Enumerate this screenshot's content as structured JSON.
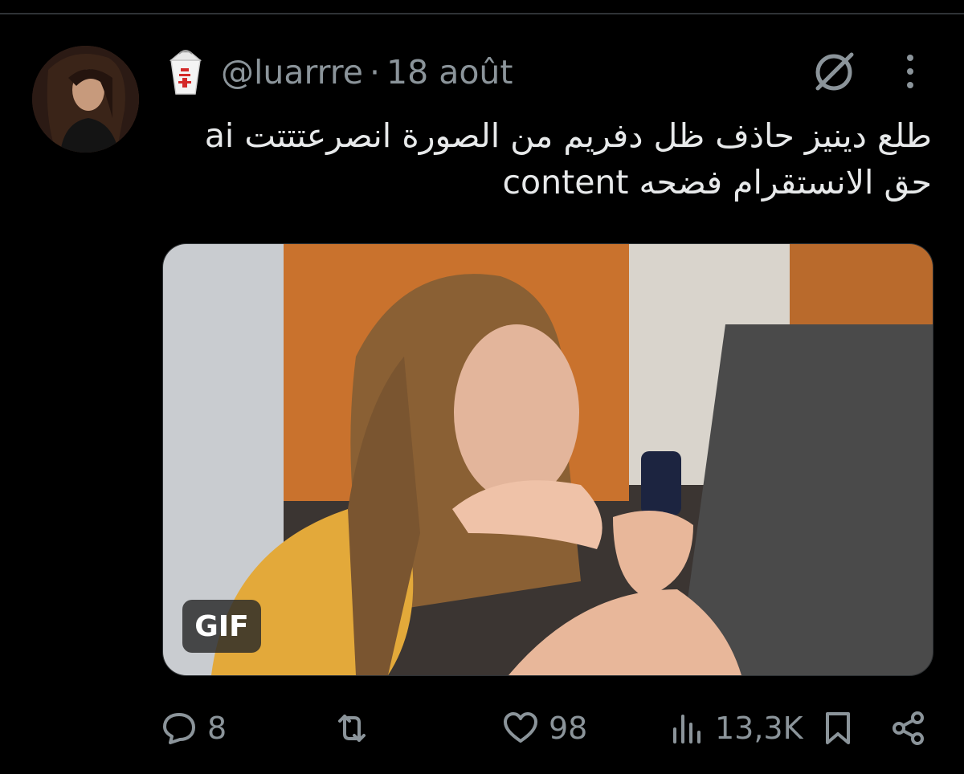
{
  "tweet": {
    "handle": "@luarrre",
    "separator": "·",
    "date": "18 août",
    "text_line1": "طلع دينيز حاذف ظل دفريم من الصورة انصرعتتتت ai",
    "text_line2": "content حق الانستقرام فضحه",
    "media": {
      "badge": "GIF"
    },
    "stats": {
      "replies": "8",
      "likes": "98",
      "views": "13,3K"
    }
  },
  "icons": {
    "avatar": "profile-photo",
    "author_emoji": "takeout-box-icon",
    "grok": "grok-icon",
    "more": "more-vertical-icon",
    "reply": "reply-icon",
    "retweet": "retweet-icon",
    "like": "heart-icon",
    "views": "views-chart-icon",
    "bookmark": "bookmark-icon",
    "share": "share-icon"
  },
  "colors": {
    "background": "#000000",
    "text": "#e7e9ea",
    "muted": "#8b949a",
    "divider": "#2f3336"
  }
}
